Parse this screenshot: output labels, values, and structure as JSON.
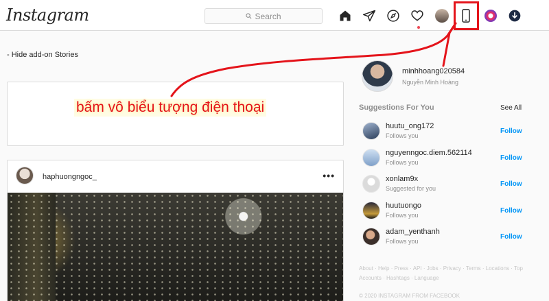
{
  "header": {
    "logo": "Instagram",
    "search_placeholder": "Search",
    "icons": [
      "home-icon",
      "direct-icon",
      "explore-icon",
      "activity-heart-icon",
      "profile-avatar",
      "mobile-phone-icon",
      "extension-icon",
      "download-icon"
    ]
  },
  "stories": {
    "hide_label": "- Hide add-on Stories"
  },
  "annotation": {
    "text": "bấm vô biểu tượng điện thoại",
    "color": "#e4141b"
  },
  "post": {
    "username": "haphuongngoc_",
    "more": "•••"
  },
  "profile": {
    "username": "minhhoang020584",
    "full_name": "Nguyễn Minh Hoàng"
  },
  "suggestions": {
    "title": "Suggestions For You",
    "see_all": "See All",
    "items": [
      {
        "username": "huutu_ong172",
        "sub": "Follows you",
        "action": "Follow"
      },
      {
        "username": "nguyenngoc.diem.562114",
        "sub": "Follows you",
        "action": "Follow"
      },
      {
        "username": "xonlam9x",
        "sub": "Suggested for you",
        "action": "Follow"
      },
      {
        "username": "huutuongo",
        "sub": "Follows you",
        "action": "Follow"
      },
      {
        "username": "adam_yenthanh",
        "sub": "Follows you",
        "action": "Follow"
      }
    ]
  },
  "footer": {
    "links": "About · Help · Press · API · Jobs · Privacy · Terms · Locations · Top Accounts · Hashtags · Language",
    "copyright": "© 2020 INSTAGRAM FROM FACEBOOK"
  },
  "colors": {
    "accent_blue": "#0095f6",
    "annotation_red": "#e4141b"
  }
}
